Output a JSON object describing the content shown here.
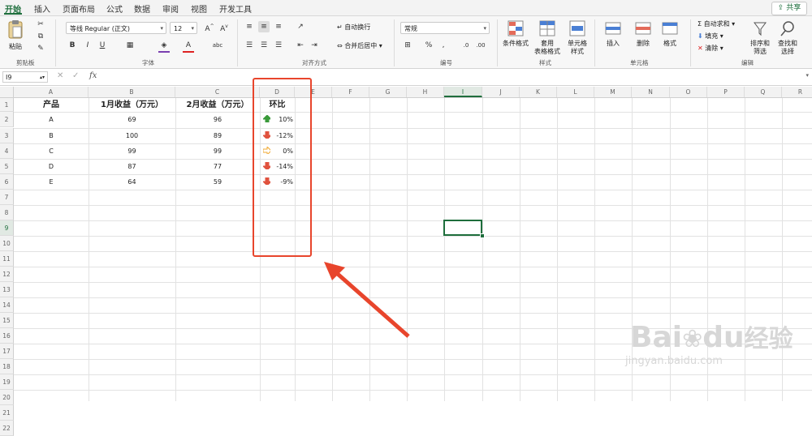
{
  "tabs": [
    "开始",
    "插入",
    "页面布局",
    "公式",
    "数据",
    "审阅",
    "视图",
    "开发工具"
  ],
  "share_label": "共享",
  "ribbon": {
    "paste": "粘贴",
    "clipboard_group": "剪贴板",
    "font_name": "等线 Regular (正文)",
    "font_size": "12",
    "font_group": "字体",
    "wrap_text": "自动换行",
    "merge_center": "合并后居中",
    "align_group": "对齐方式",
    "number_format": "常规",
    "number_group": "编号",
    "cond_format": "条件格式",
    "table_format_1": "套用",
    "table_format_2": "表格格式",
    "cell_style_1": "单元格",
    "cell_style_2": "样式",
    "style_group": "样式",
    "insert": "插入",
    "delete": "删除",
    "format": "格式",
    "cells_group": "单元格",
    "autosum": "自动求和",
    "fill": "填充",
    "clear": "清除",
    "sort_filter_1": "排序和",
    "sort_filter_2": "筛选",
    "find_select_1": "查找和",
    "find_select_2": "选择",
    "edit_group": "编辑"
  },
  "formula_bar": {
    "name_box": "I9",
    "fx": "fx",
    "formula": ""
  },
  "columns": [
    "A",
    "B",
    "C",
    "D",
    "E",
    "F",
    "G",
    "H",
    "I",
    "J",
    "K",
    "L",
    "M",
    "N",
    "O",
    "P",
    "Q",
    "R"
  ],
  "selected_column": "I",
  "rows": [
    "1",
    "2",
    "3",
    "4",
    "5",
    "6",
    "7",
    "8",
    "9",
    "10",
    "11",
    "12",
    "13",
    "14",
    "15",
    "16",
    "17",
    "18",
    "19",
    "20",
    "21",
    "22"
  ],
  "selected_row": "9",
  "table": {
    "headers": [
      "产品",
      "1月收益（万元）",
      "2月收益（万元）",
      "环比"
    ],
    "rows": [
      {
        "product": "A",
        "jan": "69",
        "feb": "96",
        "ratio": "10%",
        "trend": "up"
      },
      {
        "product": "B",
        "jan": "100",
        "feb": "89",
        "ratio": "-12%",
        "trend": "down"
      },
      {
        "product": "C",
        "jan": "99",
        "feb": "99",
        "ratio": "0%",
        "trend": "flat"
      },
      {
        "product": "D",
        "jan": "87",
        "feb": "77",
        "ratio": "-14%",
        "trend": "down"
      },
      {
        "product": "E",
        "jan": "64",
        "feb": "59",
        "ratio": "-9%",
        "trend": "down"
      }
    ]
  },
  "colors": {
    "accent": "#1e6e3c",
    "up": "#3a9a3a",
    "down": "#e0523e",
    "flat": "#f0a830",
    "annotation": "#e8452c"
  },
  "watermark": {
    "brand": "Bai",
    "brand2": "du",
    "text": "经验",
    "url": "jingyan.baidu.com"
  }
}
